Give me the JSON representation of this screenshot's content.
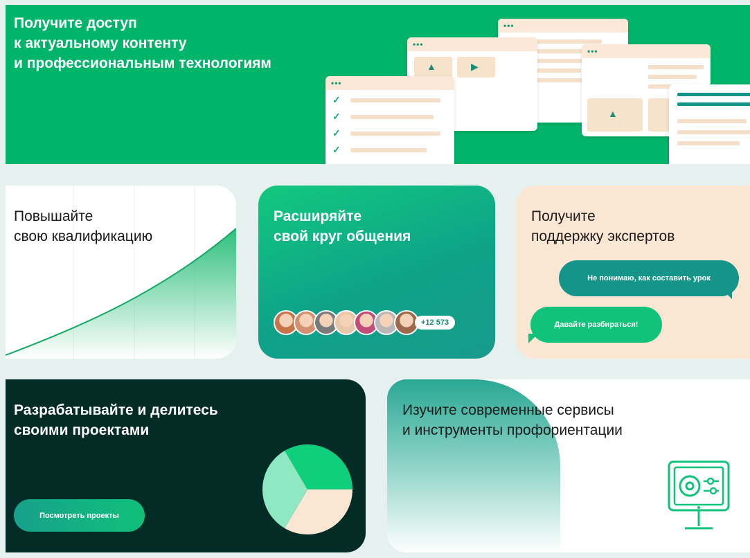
{
  "hero": {
    "title_lines": [
      "Получите доступ",
      "к актуальному контенту",
      "и профессиональным технологиям"
    ],
    "window_dots": "•••"
  },
  "qualification": {
    "title_lines": [
      "Повышайте",
      "свою квалификацию"
    ]
  },
  "network": {
    "title_lines": [
      "Расширяйте",
      "свой круг общения"
    ],
    "member_count": "+12 573",
    "avatar_colors": [
      "#c7744a",
      "#d29070",
      "#7a7a7a",
      "#e8c6a8",
      "#c24c7a",
      "#b8b8b8",
      "#9a6a4a"
    ]
  },
  "experts": {
    "title_lines": [
      "Получите",
      "поддержку экспертов"
    ],
    "messages": [
      "Не понимаю, как составить урок",
      "Давайте разбираться!"
    ]
  },
  "projects": {
    "title_lines": [
      "Разрабатывайте и делитесь",
      "своими проектами"
    ],
    "button_label": "Посмотреть проекты"
  },
  "services": {
    "title_lines": [
      "Изучите современные сервисы",
      "и инструменты профориентации"
    ]
  },
  "colors": {
    "brand_green": "#00b56a",
    "teal": "#15958a",
    "peach": "#fbe6d4",
    "dark_green": "#042c27",
    "mint": "#8ee8c2"
  },
  "icons": {
    "check": "check-icon",
    "image": "image-icon",
    "play": "play-icon",
    "monitor": "monitor-settings-icon",
    "pie": "pie-chart-icon",
    "growth": "growth-curve-icon"
  }
}
